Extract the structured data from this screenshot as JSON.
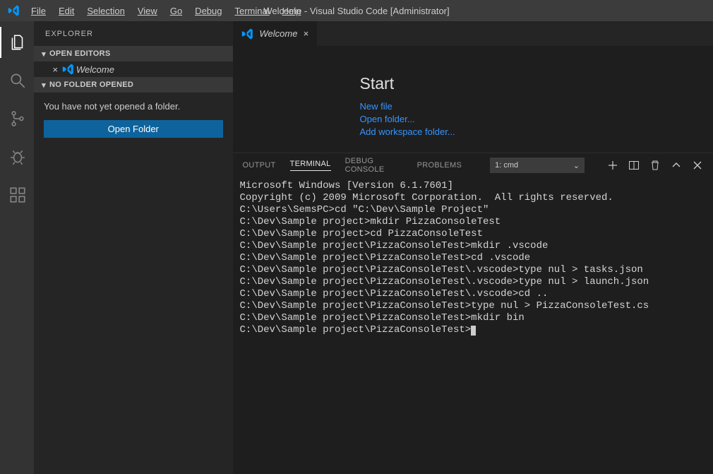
{
  "titlebar": {
    "title": "Welcome - Visual Studio Code [Administrator]",
    "menu": [
      "File",
      "Edit",
      "Selection",
      "View",
      "Go",
      "Debug",
      "Terminal",
      "Help"
    ]
  },
  "activitybar": {
    "items": [
      "explorer",
      "search",
      "scm",
      "debug",
      "extensions"
    ]
  },
  "sidebar": {
    "title": "EXPLORER",
    "open_editors_label": "OPEN EDITORS",
    "open_editor_item": "Welcome",
    "no_folder_label": "NO FOLDER OPENED",
    "no_folder_text": "You have not yet opened a folder.",
    "open_folder_button": "Open Folder"
  },
  "tabs": {
    "welcome": "Welcome"
  },
  "welcome": {
    "heading": "Start",
    "links": [
      "New file",
      "Open folder...",
      "Add workspace folder..."
    ]
  },
  "panel": {
    "tabs": [
      "OUTPUT",
      "TERMINAL",
      "DEBUG CONSOLE",
      "PROBLEMS"
    ],
    "active_tab": "TERMINAL",
    "selector": "1: cmd"
  },
  "terminal": {
    "lines": [
      "Microsoft Windows [Version 6.1.7601]",
      "Copyright (c) 2009 Microsoft Corporation.  All rights reserved.",
      "",
      "C:\\Users\\SemsPC>cd \"C:\\Dev\\Sample Project\"",
      "",
      "C:\\Dev\\Sample project>mkdir PizzaConsoleTest",
      "",
      "C:\\Dev\\Sample project>cd PizzaConsoleTest",
      "",
      "C:\\Dev\\Sample project\\PizzaConsoleTest>mkdir .vscode",
      "",
      "C:\\Dev\\Sample project\\PizzaConsoleTest>cd .vscode",
      "",
      "C:\\Dev\\Sample project\\PizzaConsoleTest\\.vscode>type nul > tasks.json",
      "",
      "C:\\Dev\\Sample project\\PizzaConsoleTest\\.vscode>type nul > launch.json",
      "",
      "C:\\Dev\\Sample project\\PizzaConsoleTest\\.vscode>cd ..",
      "",
      "C:\\Dev\\Sample project\\PizzaConsoleTest>type nul > PizzaConsoleTest.cs",
      "",
      "C:\\Dev\\Sample project\\PizzaConsoleTest>mkdir bin",
      "",
      "C:\\Dev\\Sample project\\PizzaConsoleTest>"
    ]
  }
}
